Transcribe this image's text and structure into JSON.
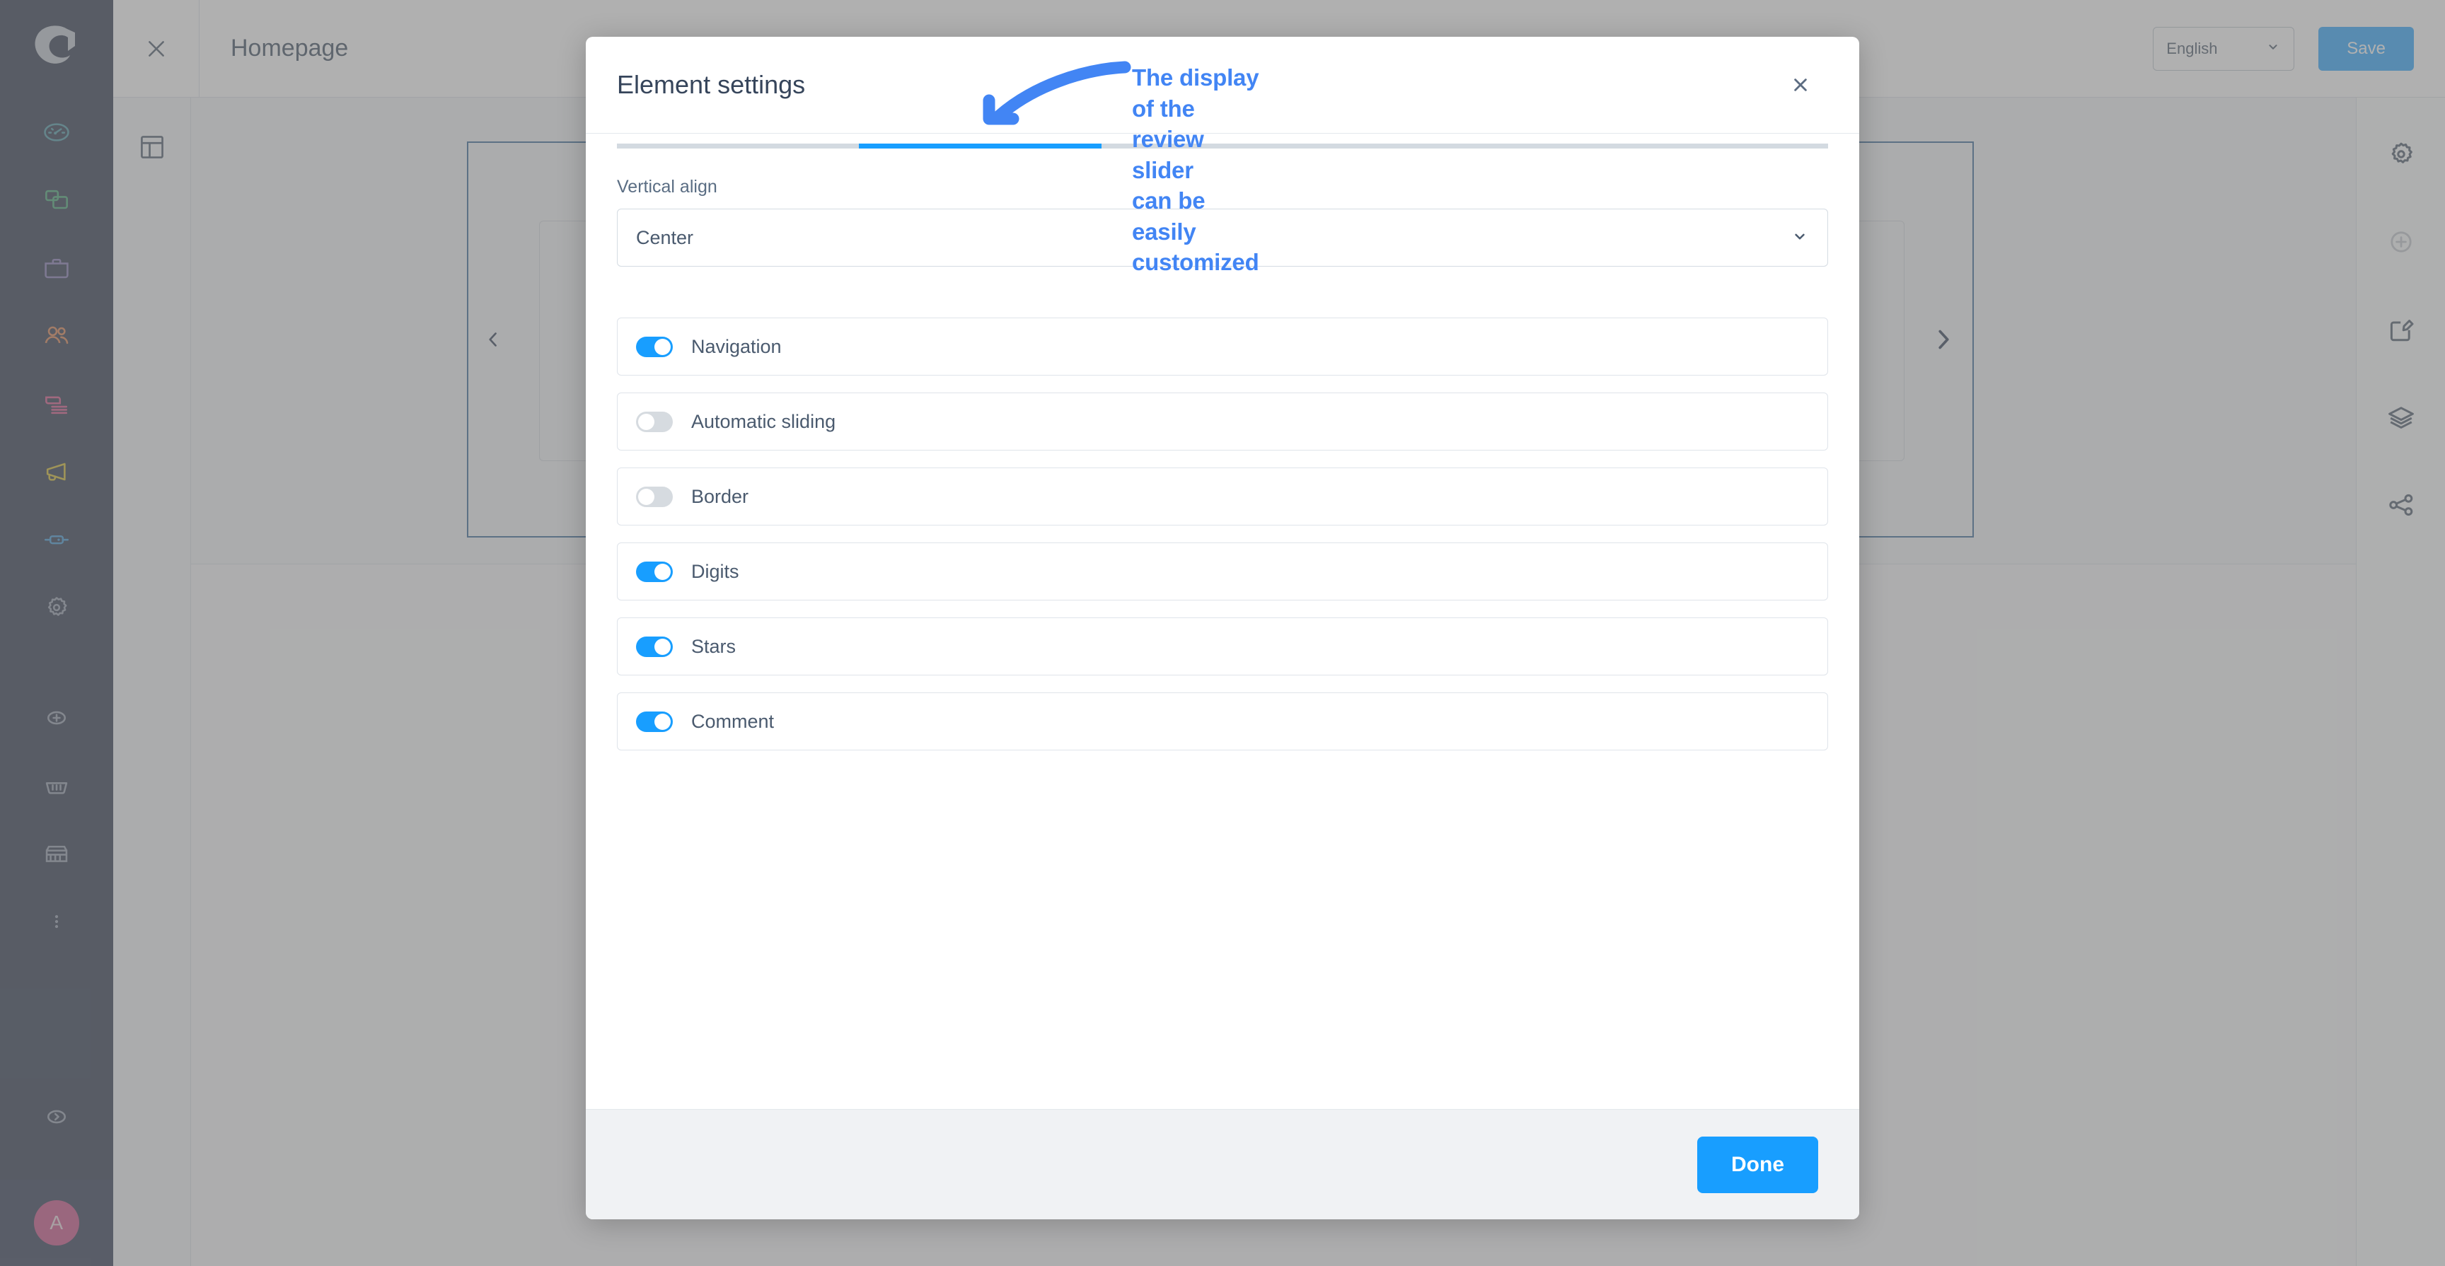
{
  "app": {
    "sidebar_left": {
      "logo_icon": "shopware-logo-icon",
      "items": [
        {
          "icon": "dashboard-gauge-icon",
          "color": "#3a8f9e"
        },
        {
          "icon": "content-copy-icon",
          "color": "#35a06a"
        },
        {
          "icon": "orders-briefcase-icon",
          "color": "#7b6fb0"
        },
        {
          "icon": "customers-people-icon",
          "color": "#d9773f"
        },
        {
          "icon": "catalogue-list-icon",
          "color": "#d4447f"
        },
        {
          "icon": "marketing-megaphone-icon",
          "color": "#d1b519"
        },
        {
          "icon": "extensions-plug-icon",
          "color": "#2f8ed1"
        },
        {
          "icon": "settings-gear-icon",
          "color": "#8a93a5"
        }
      ],
      "utility_items": [
        {
          "icon": "add-circle-icon",
          "color": "#8a93a5"
        },
        {
          "icon": "basket-icon",
          "color": "#8a93a5"
        },
        {
          "icon": "storefront-icon",
          "color": "#8a93a5"
        },
        {
          "icon": "more-vertical-icon",
          "color": "#8a93a5"
        }
      ],
      "collapse_icon": "chevron-right-circle-icon",
      "avatar_initial": "A",
      "avatar_color": "#c4407c"
    },
    "topbar": {
      "close_icon": "close-x-icon",
      "title": "Homepage",
      "devices": [
        {
          "icon": "mobile-viewport-icon",
          "active": false
        },
        {
          "icon": "tablet-viewport-icon",
          "active": false
        },
        {
          "icon": "desktop-viewport-icon",
          "active": true
        },
        {
          "icon": "wide-viewport-icon",
          "active": false
        }
      ],
      "language_value": "English",
      "language_chevron_icon": "chevron-down-icon",
      "save_label": "Save",
      "save_color": "#189eff"
    },
    "canvas": {
      "rail_icon": "layout-sections-icon",
      "slider_prev_icon": "chevron-left-icon",
      "slider_next_icon": "chevron-right-icon",
      "selection_color": "#24598f"
    },
    "sidebar_right": {
      "items": [
        {
          "icon": "gear-icon",
          "disabled": false
        },
        {
          "icon": "add-circle-icon",
          "disabled": true
        },
        {
          "icon": "edit-document-icon",
          "disabled": false
        },
        {
          "icon": "layers-icon",
          "disabled": false
        },
        {
          "icon": "share-icon",
          "disabled": false
        }
      ]
    }
  },
  "modal": {
    "title": "Element settings",
    "close_icon": "close-x-icon",
    "tabs": {
      "count": 5,
      "active_index": 1,
      "active_color": "#189eff"
    },
    "vertical_align": {
      "label": "Vertical align",
      "value": "Center",
      "chevron_icon": "chevron-down-icon"
    },
    "toggles": [
      {
        "label": "Navigation",
        "on": true
      },
      {
        "label": "Automatic sliding",
        "on": false
      },
      {
        "label": "Border",
        "on": false
      },
      {
        "label": "Digits",
        "on": true
      },
      {
        "label": "Stars",
        "on": true
      },
      {
        "label": "Comment",
        "on": true
      }
    ],
    "footer": {
      "done_label": "Done",
      "done_color": "#189eff"
    }
  },
  "annotation": {
    "text": "The display of the review slider\ncan be easily customized",
    "color": "#4285f4",
    "arrow_icon": "curved-arrow-down-left-icon"
  }
}
